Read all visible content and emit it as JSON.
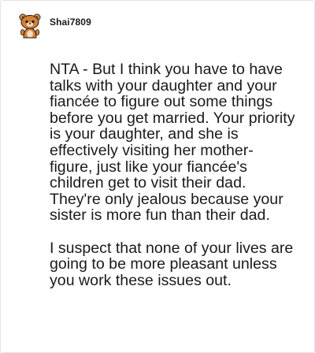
{
  "comment": {
    "author": "Shai7809",
    "avatar_icon": "reddit-snoo-avatar-icon",
    "paragraphs": [
      "NTA - But I think you have to have talks with your daughter and your fiancée to figure out some things before you get married. Your priority is your daughter, and she is effectively visiting her mother-figure, just like your fiancée's children get to visit their dad. They're only jealous because your sister is more fun than their dad.",
      "I suspect that none of your lives are going to be more pleasant unless you work these issues out."
    ]
  },
  "colors": {
    "text": "#1a1a1b",
    "border": "#e3e3e3",
    "avatar_fur": "#d4803a",
    "avatar_background": "#ffffff"
  }
}
